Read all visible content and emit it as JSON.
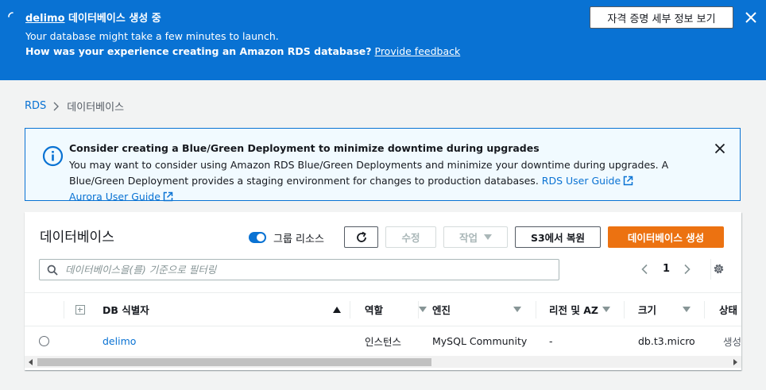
{
  "flash": {
    "db_name": "delimo",
    "title_suffix": " 데이터베이스 생성 중",
    "line1": "Your database might take a few minutes to launch.",
    "line2": "How was your experience creating an Amazon RDS database?",
    "feedback_link": "Provide feedback",
    "credentials_button": "자격 증명 세부 정보 보기",
    "background_color": "#0972d3"
  },
  "breadcrumb": {
    "items": [
      "RDS",
      "데이터베이스"
    ]
  },
  "alert": {
    "title": "Consider creating a Blue/Green Deployment to minimize downtime during upgrades",
    "body": "You may want to consider using Amazon RDS Blue/Green Deployments and minimize your downtime during upgrades. A Blue/Green Deployment provides a staging environment for changes to production databases.",
    "link1": "RDS User Guide",
    "link2": "Aurora User Guide",
    "border_color": "#0972d3",
    "background_color": "#f1faff"
  },
  "panel": {
    "title": "데이터베이스",
    "group_resources_label": "그룹 리소스",
    "group_resources_on": true,
    "buttons": {
      "edit": "수정",
      "actions": "작업",
      "restore_s3": "S3에서 복원",
      "create": "데이터베이스 생성"
    },
    "primary_color": "#ec7211",
    "search_placeholder": "데이터베이스을(를) 기준으로 필터링",
    "page_number": "1"
  },
  "table": {
    "columns": [
      "DB 식별자",
      "역할",
      "엔진",
      "리전 및 AZ",
      "크기",
      "상태"
    ],
    "rows": [
      {
        "identifier": "delimo",
        "role": "인스턴스",
        "engine": "MySQL Community",
        "region_az": "-",
        "size": "db.t3.micro",
        "status": "생성 중"
      }
    ]
  },
  "icons": {
    "flash_status": "spinner-icon",
    "flash_close": "close-icon",
    "alert": "info-icon",
    "external_link": "external-link-icon",
    "refresh": "refresh-icon",
    "search": "search-icon",
    "settings": "gear-icon",
    "status": "clock-icon"
  }
}
